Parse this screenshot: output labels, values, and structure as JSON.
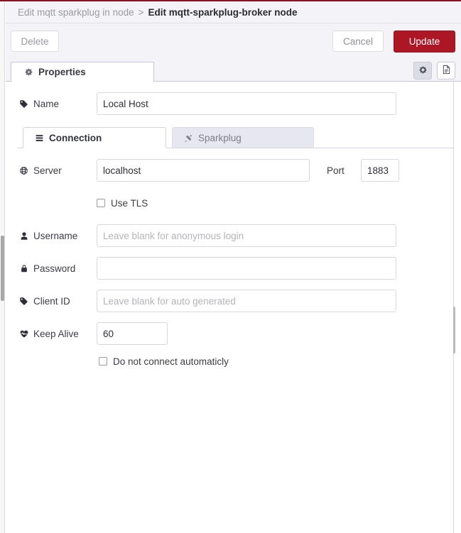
{
  "theme": {
    "accent_red": "#ad1625",
    "header_bg": "#f4f4f8",
    "inactive_tab_bg": "#e7e7f2",
    "border": "#d7d7dd",
    "text": "#333333",
    "placeholder": "#b4b4bb"
  },
  "breadcrumb": {
    "previous": "Edit mqtt sparkplug in node",
    "separator": ">",
    "current": "Edit mqtt-sparkplug-broker node"
  },
  "toolbar": {
    "delete_label": "Delete",
    "cancel_label": "Cancel",
    "update_label": "Update"
  },
  "panel_tabs": {
    "properties_label": "Properties",
    "properties_icon": "gear-icon",
    "header_buttons": [
      {
        "name": "gear-icon",
        "selected": true
      },
      {
        "name": "description-icon",
        "selected": false
      }
    ]
  },
  "form": {
    "name": {
      "label": "Name",
      "icon": "tag-icon",
      "value": "Local Host",
      "placeholder": ""
    },
    "server": {
      "label": "Server",
      "icon": "globe-icon",
      "value": "localhost",
      "placeholder": ""
    },
    "port": {
      "label": "Port",
      "value": "1883",
      "placeholder": ""
    },
    "use_tls": {
      "label": "Use TLS",
      "checked": false
    },
    "username": {
      "label": "Username",
      "icon": "user-icon",
      "value": "",
      "placeholder": "Leave blank for anonymous login"
    },
    "password": {
      "label": "Password",
      "icon": "lock-icon",
      "value": "",
      "placeholder": ""
    },
    "client_id": {
      "label": "Client ID",
      "icon": "tag-icon",
      "value": "",
      "placeholder": "Leave blank for auto generated"
    },
    "keep_alive": {
      "label": "Keep Alive",
      "icon": "heartbeat-icon",
      "value": "60",
      "placeholder": ""
    },
    "no_autoconnect": {
      "label": "Do not connect automaticly",
      "checked": false
    }
  },
  "sub_tabs": [
    {
      "label": "Connection",
      "icon": "server-icon",
      "active": true
    },
    {
      "label": "Sparkplug",
      "icon": "plug-icon",
      "active": false
    }
  ]
}
